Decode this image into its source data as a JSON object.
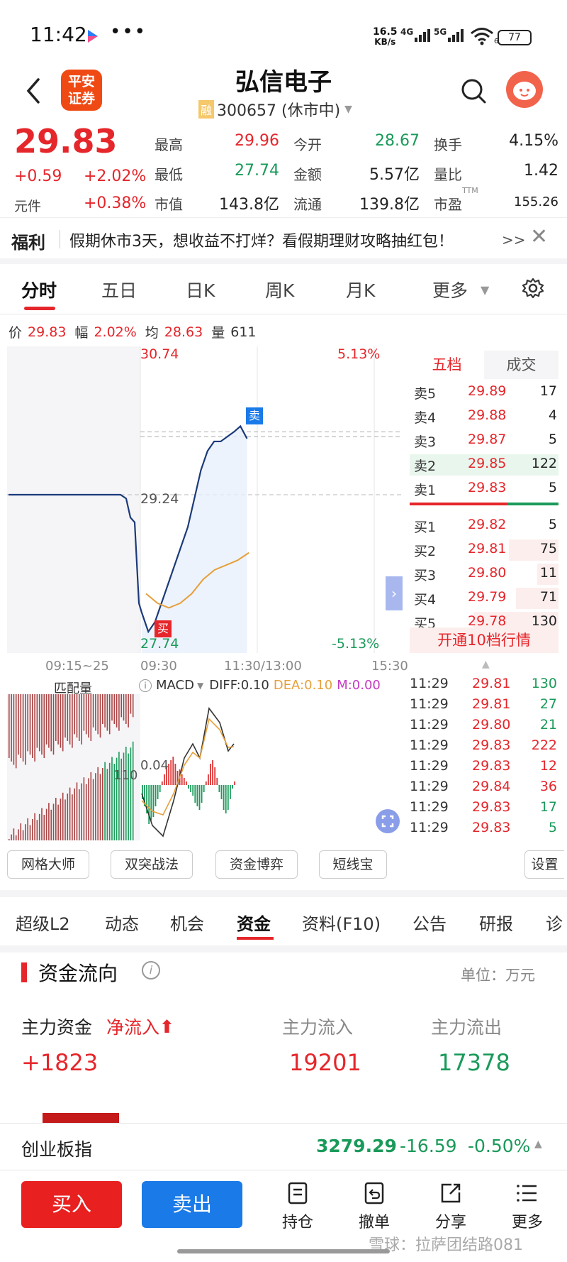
{
  "status_bar": {
    "time": "11:42",
    "net_speed": "16.5",
    "net_unit": "KB/s",
    "sig1": "4G",
    "sig2": "5G",
    "wifi_sub": "6",
    "battery": "77"
  },
  "header": {
    "brand_logo": "平安\n证券",
    "stock_name": "弘信电子",
    "rong_badge": "融",
    "stock_code": "300657 (休市中)"
  },
  "quote": {
    "price": "29.83",
    "change": "+0.59",
    "change_pct": "+2.02%",
    "unit_label": "元件",
    "unit_pct": "+0.38%",
    "fields": [
      {
        "label": "最高",
        "value": "29.96",
        "color": "#e5262b"
      },
      {
        "label": "最低",
        "value": "27.74",
        "color": "#1a9a5a"
      },
      {
        "label": "市值",
        "value": "143.8亿",
        "color": "#222222"
      },
      {
        "label": "今开",
        "value": "28.67",
        "color": "#1a9a5a"
      },
      {
        "label": "金额",
        "value": "5.57亿",
        "color": "#222222"
      },
      {
        "label": "流通",
        "value": "139.8亿",
        "color": "#222222"
      },
      {
        "label": "换手",
        "value": "4.15%",
        "color": "#222222"
      },
      {
        "label": "量比",
        "value": "1.42",
        "color": "#222222"
      },
      {
        "label": "市盈",
        "value": "155.26",
        "color": "#222222"
      }
    ],
    "ttm": "TTM"
  },
  "promo": {
    "title": "福利",
    "text": "假期休市3天，想收益不打烊？看假期理财攻略抽红包！",
    "arrow": ">>"
  },
  "chart_tabs": [
    "分时",
    "五日",
    "日K",
    "周K",
    "月K",
    "更多"
  ],
  "info_line": {
    "price_label": "价",
    "price": "29.83",
    "range_label": "幅",
    "range": "2.02%",
    "avg_label": "均",
    "avg": "28.63",
    "vol_label": "量",
    "vol": "611"
  },
  "chart_data": {
    "type": "line",
    "title": "",
    "y_high": "30.74",
    "y_mid": "29.24",
    "y_low": "27.74",
    "pct_high": "5.13%",
    "pct_low": "-5.13%",
    "x_labels": [
      "09:15~25",
      "09:30",
      "11:30/13:00",
      "15:30"
    ],
    "ylim": [
      27.74,
      30.74
    ],
    "series": [
      {
        "values": [
          29.24,
          29.24,
          29.24,
          29.24,
          29.24,
          29.2,
          29.0,
          28.95,
          28.1,
          28.0,
          27.8,
          27.9,
          28.1,
          28.3,
          28.5,
          28.7,
          28.9,
          29.2,
          29.5,
          29.7,
          29.8,
          29.8,
          29.85,
          29.9,
          29.96,
          29.83
        ]
      },
      {
        "values": [
          28.2,
          28.1,
          28.05,
          28.1,
          28.2,
          28.35,
          28.45,
          28.5,
          28.55,
          28.63
        ]
      }
    ],
    "sell_marker": "卖",
    "buy_marker": "买"
  },
  "order_book": {
    "tabs": [
      "五档",
      "成交"
    ],
    "asks": [
      {
        "label": "卖5",
        "price": "29.89",
        "vol": "17"
      },
      {
        "label": "卖4",
        "price": "29.88",
        "vol": "4"
      },
      {
        "label": "卖3",
        "price": "29.87",
        "vol": "5"
      },
      {
        "label": "卖2",
        "price": "29.85",
        "vol": "122"
      },
      {
        "label": "卖1",
        "price": "29.83",
        "vol": "5"
      }
    ],
    "bids": [
      {
        "label": "买1",
        "price": "29.82",
        "vol": "5"
      },
      {
        "label": "买2",
        "price": "29.81",
        "vol": "75"
      },
      {
        "label": "买3",
        "price": "29.80",
        "vol": "11"
      },
      {
        "label": "买4",
        "price": "29.79",
        "vol": "71"
      },
      {
        "label": "买5",
        "price": "29.78",
        "vol": "130"
      }
    ],
    "upgrade": "开通10档行情"
  },
  "ticks": [
    {
      "time": "11:29",
      "price": "29.81",
      "vol": "130",
      "color": "#1a9a5a"
    },
    {
      "time": "11:29",
      "price": "29.81",
      "vol": "27",
      "color": "#1a9a5a"
    },
    {
      "time": "11:29",
      "price": "29.80",
      "vol": "21",
      "color": "#1a9a5a"
    },
    {
      "time": "11:29",
      "price": "29.83",
      "vol": "222",
      "color": "#e5262b"
    },
    {
      "time": "11:29",
      "price": "29.83",
      "vol": "12",
      "color": "#e5262b"
    },
    {
      "time": "11:29",
      "price": "29.84",
      "vol": "36",
      "color": "#e5262b"
    },
    {
      "time": "11:29",
      "price": "29.83",
      "vol": "17",
      "color": "#1a9a5a"
    },
    {
      "time": "11:29",
      "price": "29.83",
      "vol": "5",
      "color": "#1a9a5a"
    }
  ],
  "macd": {
    "match_label": "匹配量",
    "name": "MACD",
    "diff": "DIFF:0.10",
    "dea": "DEA:0.10",
    "m": "M:0.00",
    "label_a": "0.04",
    "label_b": "110"
  },
  "strategy_buttons": [
    "网格大师",
    "双突战法",
    "资金博弈",
    "短线宝"
  ],
  "settings_label": "设置",
  "section_tabs": [
    "超级L2",
    "动态",
    "机会",
    "资金",
    "资料(F10)",
    "公告",
    "研报",
    "诊"
  ],
  "capital_flow": {
    "title": "资金流向",
    "info": "i",
    "unit": "单位：万元",
    "main_label": "主力资金",
    "net_label": "净流入",
    "net_value": "+1823",
    "in_label": "主力流入",
    "in_value": "19201",
    "out_label": "主力流出",
    "out_value": "17378"
  },
  "index_bar": {
    "name": "创业板指",
    "value": "3279.29",
    "change": "-16.59",
    "pct": "-0.50%"
  },
  "bottom_nav": {
    "buy": "买入",
    "sell": "卖出",
    "items": [
      "持仓",
      "撤单",
      "分享",
      "更多"
    ]
  },
  "watermark": "雪球：拉萨团结路081"
}
